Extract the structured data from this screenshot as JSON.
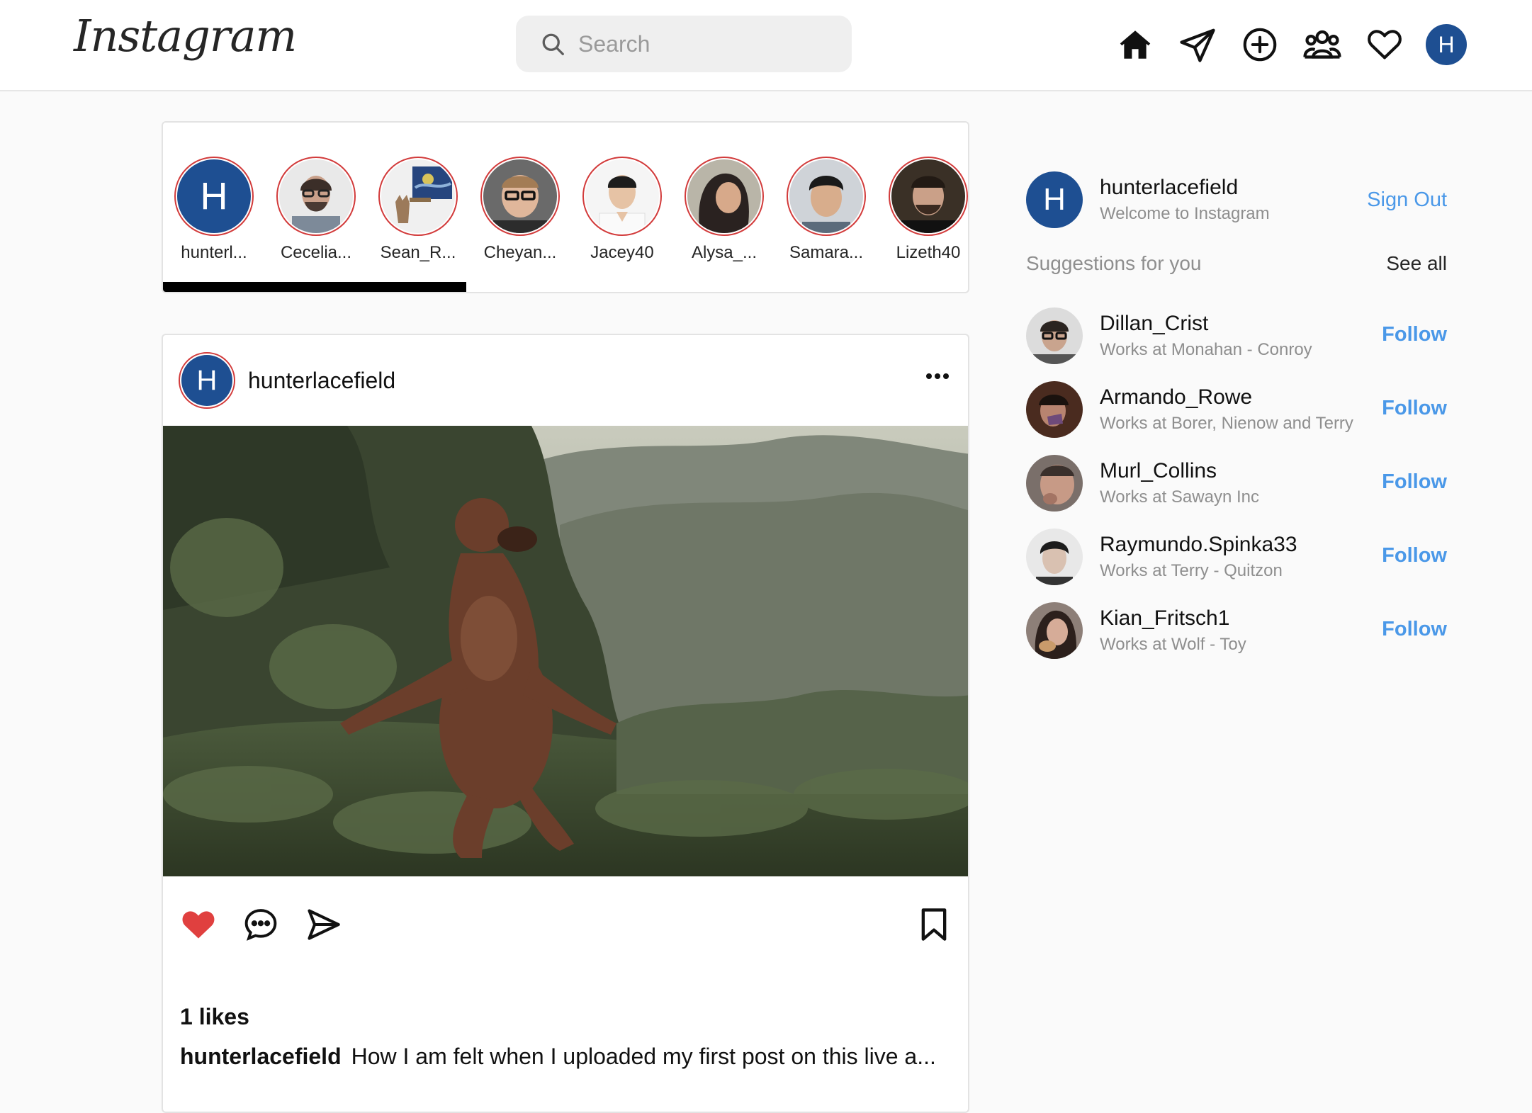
{
  "header": {
    "logo": "Instagram",
    "search_placeholder": "Search",
    "nav_icons": [
      "home-icon",
      "send-icon",
      "add-post-icon",
      "people-icon",
      "heart-icon"
    ],
    "avatar_initial": "H"
  },
  "stories": {
    "items": [
      {
        "name": "hunterl...",
        "initial": "H"
      },
      {
        "name": "Cecelia..."
      },
      {
        "name": "Sean_R..."
      },
      {
        "name": "Cheyan..."
      },
      {
        "name": "Jacey40"
      },
      {
        "name": "Alysa_..."
      },
      {
        "name": "Samara..."
      },
      {
        "name": "Lizeth40"
      }
    ]
  },
  "post": {
    "username": "hunterlacefield",
    "avatar_initial": "H",
    "likes": "1 likes",
    "caption_user": "hunterlacefield",
    "caption_text": "How I am felt when I uploaded my first post on this live a..."
  },
  "sidebar": {
    "me": {
      "initial": "H",
      "username": "hunterlacefield",
      "subtitle": "Welcome to Instagram",
      "sign_out": "Sign Out"
    },
    "suggestions_title": "Suggestions for you",
    "see_all": "See all",
    "suggestions": [
      {
        "username": "Dillan_Crist",
        "subtitle": "Works at Monahan - Conroy",
        "action": "Follow"
      },
      {
        "username": "Armando_Rowe",
        "subtitle": "Works at Borer, Nienow and Terry",
        "action": "Follow"
      },
      {
        "username": "Murl_Collins",
        "subtitle": "Works at Sawayn Inc",
        "action": "Follow"
      },
      {
        "username": "Raymundo.Spinka33",
        "subtitle": "Works at Terry - Quitzon",
        "action": "Follow"
      },
      {
        "username": "Kian_Fritsch1",
        "subtitle": "Works at Wolf - Toy",
        "action": "Follow"
      }
    ]
  },
  "colors": {
    "accent": "#4a98e8",
    "avatar_blue": "#1e4f92",
    "story_ring": "#d23b3b",
    "like_red": "#e0403f"
  }
}
